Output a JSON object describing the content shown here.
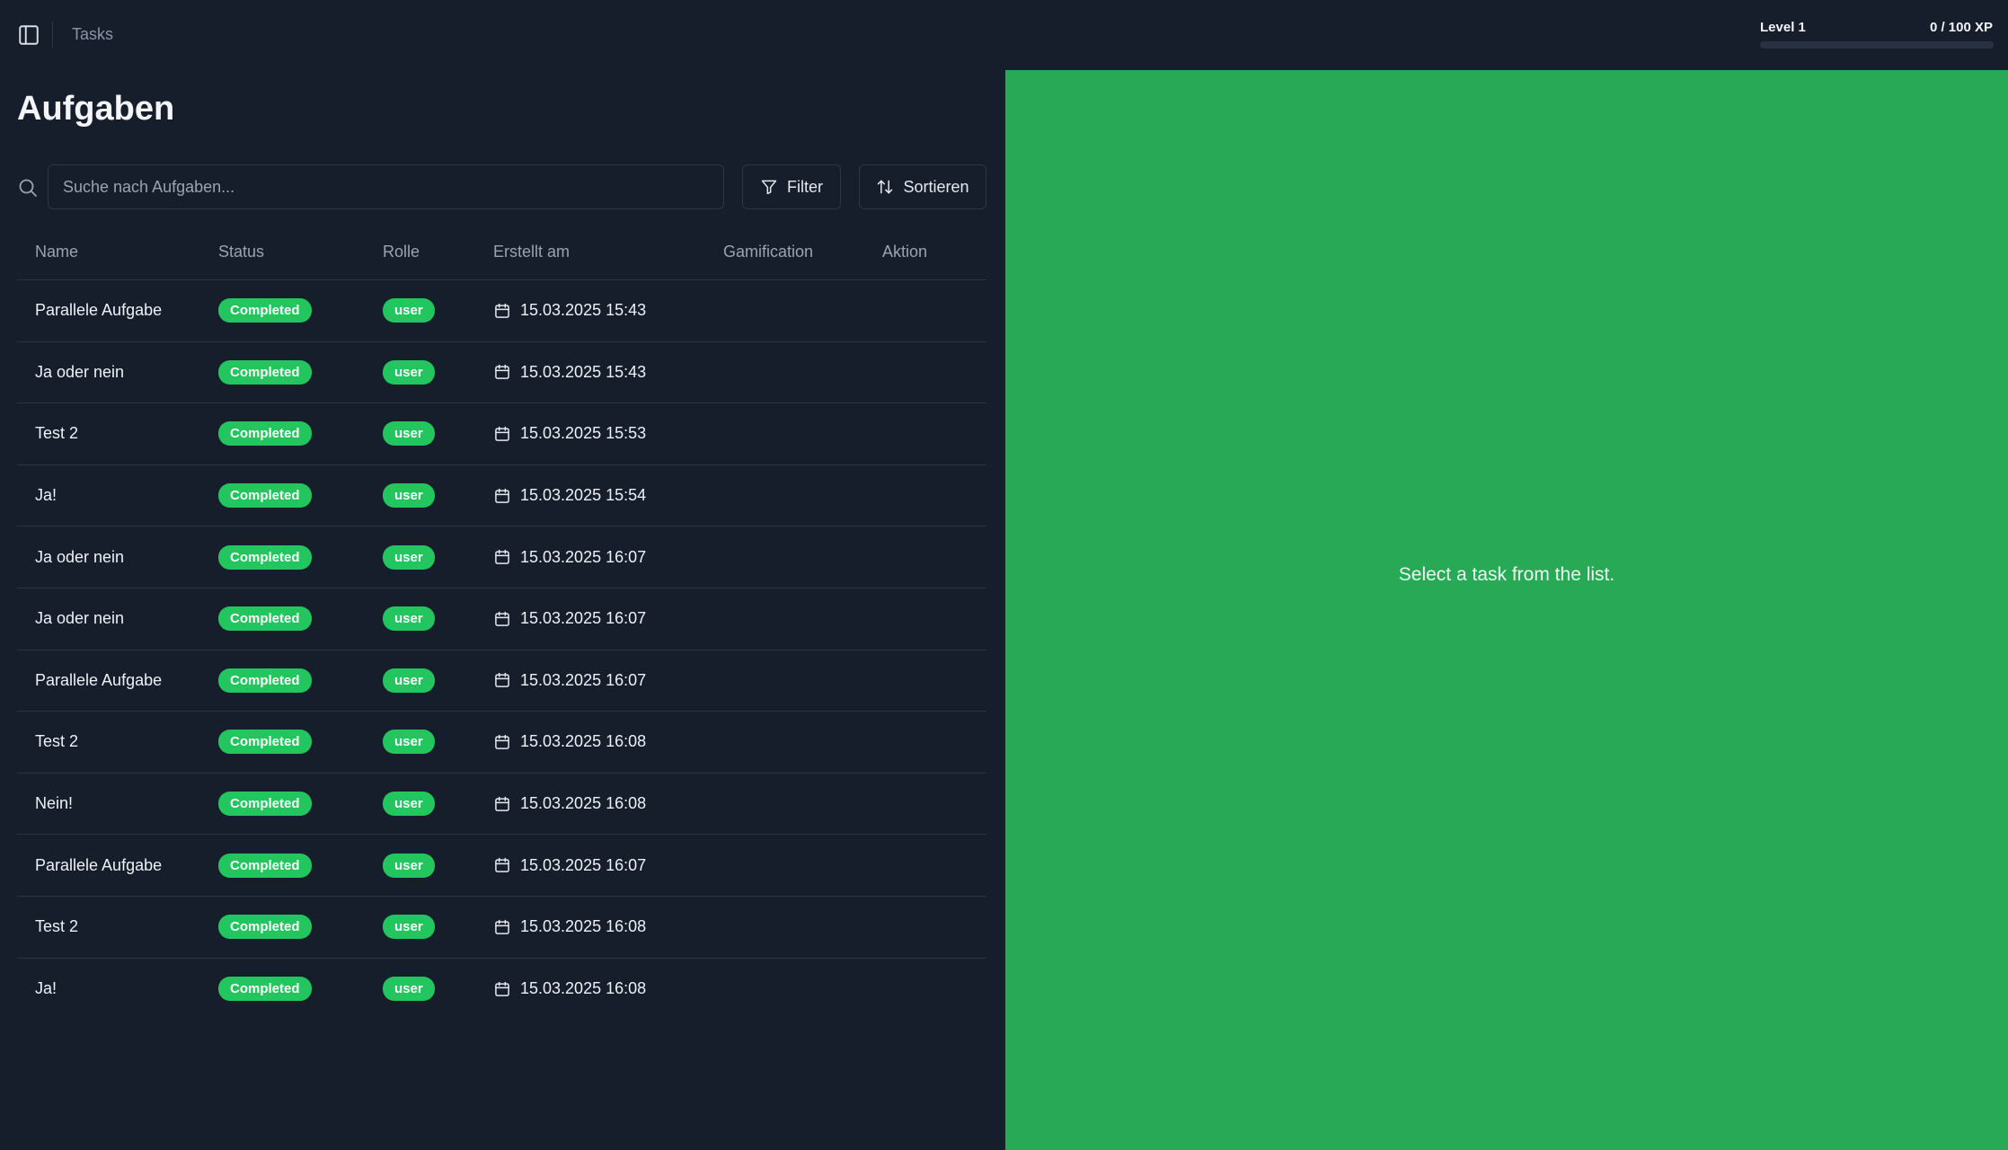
{
  "breadcrumb": "Tasks",
  "level": {
    "label": "Level 1",
    "xp_text": "0 / 100 XP",
    "progress": 0
  },
  "page_title": "Aufgaben",
  "search": {
    "placeholder": "Suche nach Aufgaben..."
  },
  "toolbar": {
    "filter_label": "Filter",
    "sort_label": "Sortieren"
  },
  "table": {
    "columns": [
      "Name",
      "Status",
      "Rolle",
      "Erstellt am",
      "Gamification",
      "Aktion"
    ],
    "rows": [
      {
        "name": "Parallele Aufgabe",
        "status": "Completed",
        "role": "user",
        "created": "15.03.2025 15:43"
      },
      {
        "name": "Ja oder nein",
        "status": "Completed",
        "role": "user",
        "created": "15.03.2025 15:43"
      },
      {
        "name": "Test 2",
        "status": "Completed",
        "role": "user",
        "created": "15.03.2025 15:53"
      },
      {
        "name": "Ja!",
        "status": "Completed",
        "role": "user",
        "created": "15.03.2025 15:54"
      },
      {
        "name": "Ja oder nein",
        "status": "Completed",
        "role": "user",
        "created": "15.03.2025 16:07"
      },
      {
        "name": "Ja oder nein",
        "status": "Completed",
        "role": "user",
        "created": "15.03.2025 16:07"
      },
      {
        "name": "Parallele Aufgabe",
        "status": "Completed",
        "role": "user",
        "created": "15.03.2025 16:07"
      },
      {
        "name": "Test 2",
        "status": "Completed",
        "role": "user",
        "created": "15.03.2025 16:08"
      },
      {
        "name": "Nein!",
        "status": "Completed",
        "role": "user",
        "created": "15.03.2025 16:08"
      },
      {
        "name": "Parallele Aufgabe",
        "status": "Completed",
        "role": "user",
        "created": "15.03.2025 16:07"
      },
      {
        "name": "Test 2",
        "status": "Completed",
        "role": "user",
        "created": "15.03.2025 16:08"
      },
      {
        "name": "Ja!",
        "status": "Completed",
        "role": "user",
        "created": "15.03.2025 16:08"
      }
    ]
  },
  "detail": {
    "empty_message": "Select a task from the list."
  },
  "icons": {
    "sidebar_toggle": "sidebar-toggle-icon",
    "search": "search-icon",
    "filter": "filter-icon",
    "sort": "sort-icon",
    "calendar": "calendar-icon"
  },
  "colors": {
    "background": "#161d2b",
    "accent": "#22c55e",
    "detail_panel": "#27a955"
  }
}
